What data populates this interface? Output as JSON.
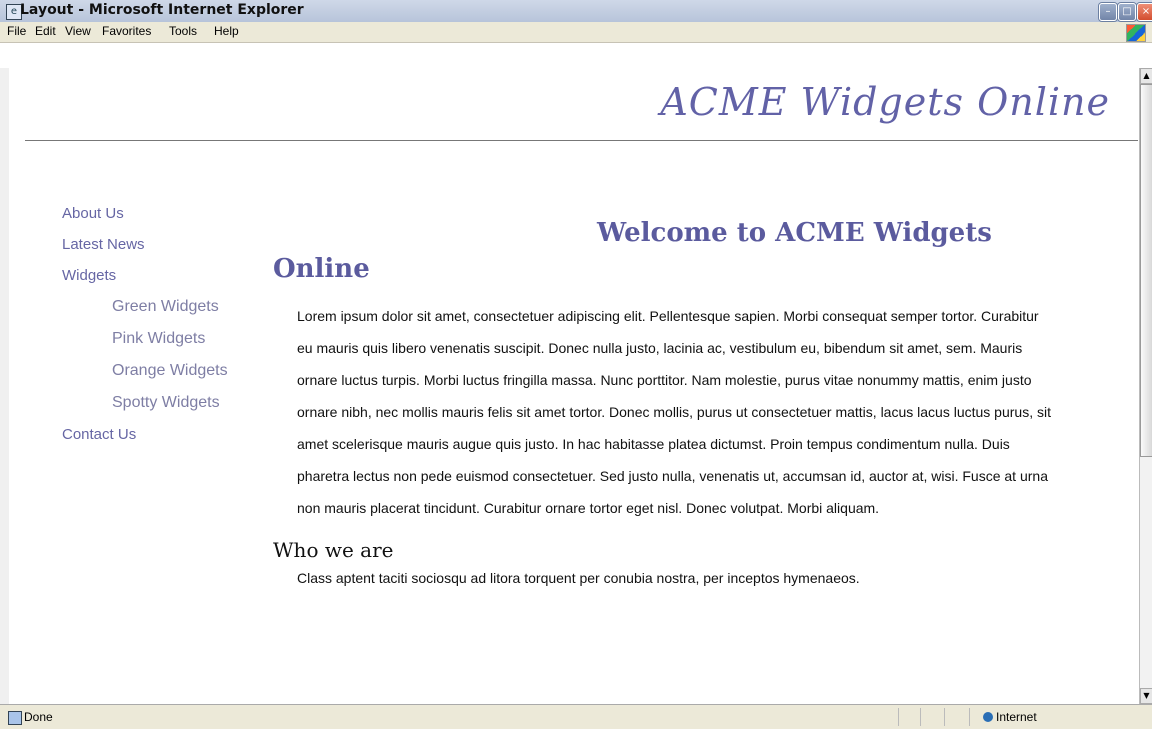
{
  "browser": {
    "title": "Layout - Microsoft Internet Explorer",
    "menu": [
      "File",
      "Edit",
      "View",
      "Favorites",
      "Tools",
      "Help"
    ],
    "status": "Done",
    "zone": "Internet"
  },
  "page": {
    "site_title": "ACME Widgets Online",
    "nav": {
      "about": "About Us",
      "news": "Latest News",
      "widgets": "Widgets",
      "widget_items": [
        "Green Widgets",
        "Pink Widgets",
        "Orange Widgets",
        "Spotty Widgets"
      ],
      "contact": "Contact Us"
    },
    "welcome_line1": "Welcome to ACME Widgets",
    "welcome_line2": "Online",
    "body_text": "Lorem ipsum dolor sit amet, consectetuer adipiscing elit. Pellentesque sapien. Morbi consequat semper tortor. Curabitur eu mauris quis libero venenatis suscipit. Donec nulla justo, lacinia ac, vestibulum eu, bibendum sit amet, sem. Mauris ornare luctus turpis. Morbi luctus fringilla massa. Nunc porttitor. Nam molestie, purus vitae nonummy mattis, enim justo ornare nibh, nec mollis mauris felis sit amet tortor. Donec mollis, purus ut consectetuer mattis, lacus lacus luctus purus, sit amet scelerisque mauris augue quis justo. In hac habitasse platea dictumst. Proin tempus condimentum nulla. Duis pharetra lectus non pede euismod consectetuer. Sed justo nulla, venenatis ut, accumsan id, auctor at, wisi. Fusce at urna non mauris placerat tincidunt. Curabitur ornare tortor eget nisl. Donec volutpat. Morbi aliquam.",
    "section_title": "Who we are",
    "section_text": "Class aptent taciti sociosqu ad litora torquent per conubia nostra, per inceptos hymenaeos."
  }
}
